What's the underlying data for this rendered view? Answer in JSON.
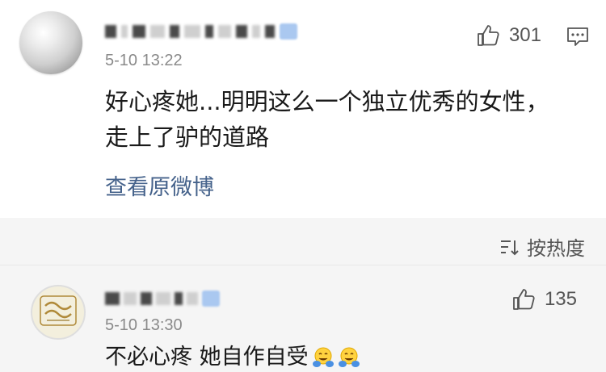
{
  "comments": [
    {
      "username": "",
      "time": "5-10 13:22",
      "likes": "301",
      "text_line1": "好心疼她...明明这么一个独立优秀的女性，",
      "text_line2": "走上了驴的道路",
      "view_original": "查看原微博"
    },
    {
      "username": "",
      "time": "5-10 13:30",
      "likes": "135",
      "text": "不必心疼 她自作自受"
    }
  ],
  "sort": {
    "label": "按热度"
  },
  "icons": {
    "like": "thumbs-up-icon",
    "reply": "comment-icon",
    "sort": "sort-icon",
    "emoji": "hugging-face-emoji"
  },
  "colors": {
    "link": "#45628b",
    "meta": "#8a8a8a",
    "background": "#f5f5f5"
  }
}
